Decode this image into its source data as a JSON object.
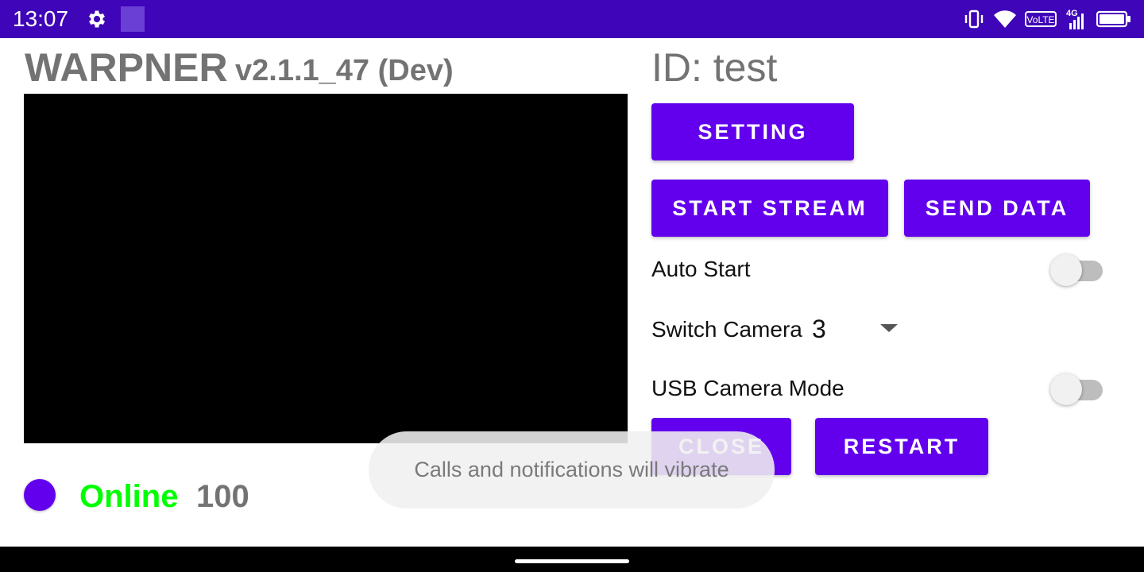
{
  "status_bar": {
    "time": "13:07",
    "left_icons": [
      "gear-icon",
      "app-square-icon"
    ],
    "right_icons": [
      "vibrate-icon",
      "wifi-icon",
      "volte-icon",
      "signal-4g-icon",
      "battery-icon"
    ],
    "volte_label": "VoLTE",
    "network_label": "4G",
    "background_color": "#3f05b8"
  },
  "header": {
    "app_name": "WARPNER",
    "version": "v2.1.1_47 (Dev)",
    "device_id": "ID: test"
  },
  "buttons": {
    "setting": "SETTING",
    "start_stream": "START STREAM",
    "send_data": "SEND DATA",
    "close": "CLOSE",
    "restart": "RESTART"
  },
  "settings": {
    "auto_start_label": "Auto Start",
    "auto_start_on": false,
    "switch_camera_label": "Switch Camera",
    "switch_camera_value": "3",
    "usb_camera_label": "USB Camera Mode",
    "usb_camera_on": false
  },
  "status": {
    "connection": "Online",
    "count": "100",
    "connection_color": "#00ff00"
  },
  "toast": {
    "message": "Calls and notifications will vibrate"
  },
  "colors": {
    "accent": "#6200ee",
    "text_gray": "#737373"
  }
}
